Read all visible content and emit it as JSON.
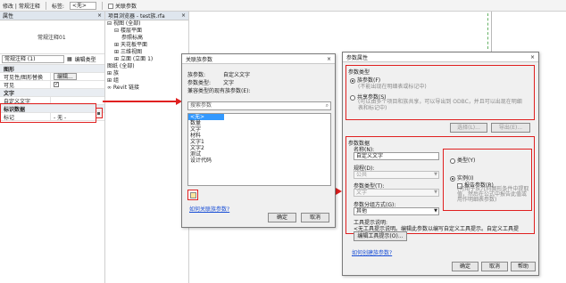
{
  "toolbar": {
    "context": "修改 | 常规注释",
    "label_sign": "标签:",
    "sign_value": "<无>",
    "association": "关联参数"
  },
  "properties": {
    "title": "属性",
    "type_name": "常规注释01",
    "instance_selector": "常规注释 (1)",
    "edit_type": "编辑类型",
    "rows": [
      {
        "key": "图形",
        "value": "",
        "group": true
      },
      {
        "key": "可见性/图形替换",
        "value": "编辑...",
        "button": true
      },
      {
        "key": "可见",
        "value": "",
        "checkbox": true
      },
      {
        "key": "文字",
        "value": "",
        "group": true
      },
      {
        "key": "自定义文字",
        "value": ""
      },
      {
        "key": "标识数据",
        "value": "",
        "group": true
      },
      {
        "key": "标记",
        "value": "- 无 -"
      }
    ]
  },
  "browser": {
    "title": "项目浏览器 - test族.rfa",
    "items": [
      {
        "label": "视图 (全部)",
        "indent": 0,
        "prefix": "⊟"
      },
      {
        "label": "楼层平面",
        "indent": 1,
        "prefix": "⊟"
      },
      {
        "label": "参照标高",
        "indent": 2,
        "prefix": ""
      },
      {
        "label": "天花板平面",
        "indent": 1,
        "prefix": "⊞"
      },
      {
        "label": "三维视图",
        "indent": 1,
        "prefix": "⊞"
      },
      {
        "label": "立面 (立面 1)",
        "indent": 1,
        "prefix": "⊞"
      },
      {
        "label": "图纸 (全部)",
        "indent": 0,
        "prefix": ""
      },
      {
        "label": "族",
        "indent": 0,
        "prefix": "⊞"
      },
      {
        "label": "组",
        "indent": 0,
        "prefix": "⊞"
      },
      {
        "label": "Revit 链接",
        "indent": 0,
        "prefix": "∞"
      }
    ]
  },
  "shared_dialog": {
    "title": "关联族参数",
    "close": "×",
    "family_param_label": "族参数:",
    "family_param_value": "自定义文字",
    "param_type_label": "参数类型:",
    "param_type_value": "文字",
    "compatible_label": "兼容类型的现有族参数(E):",
    "search_placeholder": "搜索参数",
    "items": [
      "<无>",
      "数量",
      "文字",
      "材料",
      "文字1",
      "文字2",
      "测试",
      "设计代码"
    ],
    "add_link": "如何关联族参数?",
    "ok": "确定",
    "cancel": "取消"
  },
  "param_dialog": {
    "title": "参数属性",
    "close": "×",
    "param_category_label": "参数类型",
    "family_param_label": "族参数(F)",
    "family_param_desc": "(不能出现在明细表或标记中)",
    "shared_param_label": "共享参数(S)",
    "shared_param_desc": "(可以由多个项目和族共享，可以导出到 ODBC，并且可以出现在明细表和标记中)",
    "select_btn": "选择(L)...",
    "export_btn": "导出(E)...",
    "data_label": "参数数据",
    "name_label": "名称(N):",
    "name_value": "自定义文字",
    "discipline_label": "规程(D):",
    "discipline_value": "公共",
    "type_label": "参数类型(T):",
    "type_value": "文字",
    "group_label": "参数分组方式(G):",
    "group_value": "其他",
    "type_radio": "类型(Y)",
    "instance_radio": "实例(I)",
    "report_label": "报告参数(R)",
    "report_desc": "(可用于从几何图形条件中提取值，然后在公式中报告此值或用作明细表参数)",
    "tooltip_label": "工具提示说明:",
    "tooltip_value": "<无工具提示说明。编辑此参数以编写自定义工具提示。自定义工具提",
    "edit_tooltip_btn": "编辑工具提示(O)...",
    "help_link": "如何创建族参数?",
    "ok": "确定",
    "cancel": "取消",
    "help": "帮助"
  },
  "colors": {
    "highlight": "#e02020",
    "selection": "#3399ff",
    "link": "#1a4fd6"
  }
}
